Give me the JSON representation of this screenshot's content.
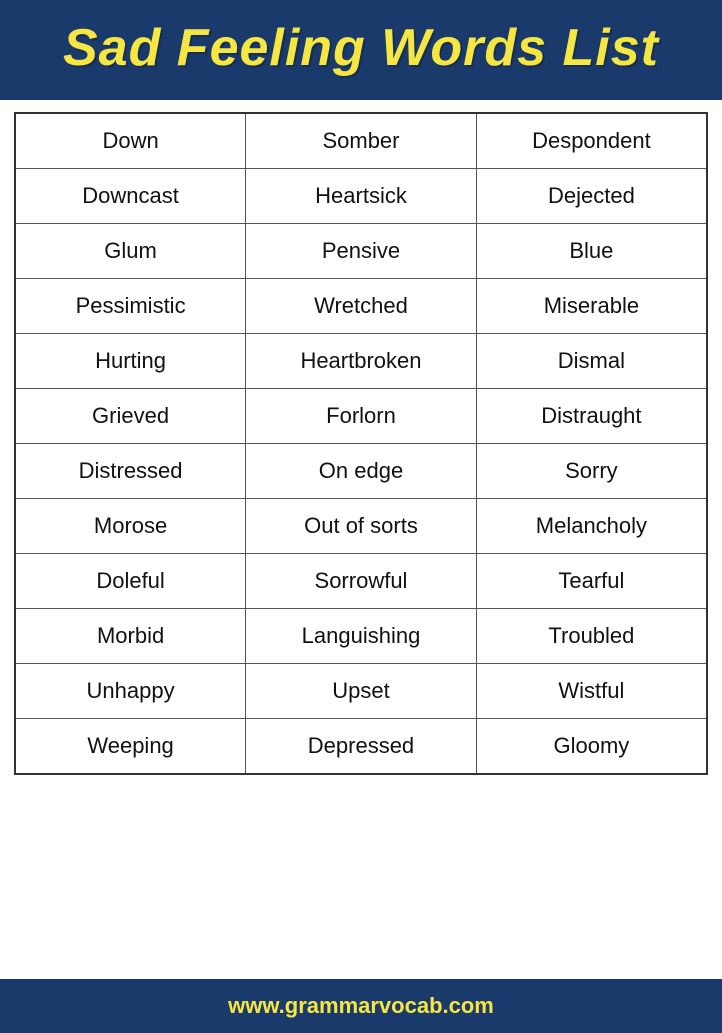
{
  "header": {
    "title": "Sad Feeling Words List"
  },
  "table": {
    "rows": [
      [
        "Down",
        "Somber",
        "Despondent"
      ],
      [
        "Downcast",
        "Heartsick",
        "Dejected"
      ],
      [
        "Glum",
        "Pensive",
        "Blue"
      ],
      [
        "Pessimistic",
        "Wretched",
        "Miserable"
      ],
      [
        "Hurting",
        "Heartbroken",
        "Dismal"
      ],
      [
        "Grieved",
        "Forlorn",
        "Distraught"
      ],
      [
        "Distressed",
        "On edge",
        "Sorry"
      ],
      [
        "Morose",
        "Out of sorts",
        "Melancholy"
      ],
      [
        "Doleful",
        "Sorrowful",
        "Tearful"
      ],
      [
        "Morbid",
        "Languishing",
        "Troubled"
      ],
      [
        "Unhappy",
        "Upset",
        "Wistful"
      ],
      [
        "Weeping",
        "Depressed",
        "Gloomy"
      ]
    ]
  },
  "footer": {
    "text": "www.grammarvocab.com"
  }
}
